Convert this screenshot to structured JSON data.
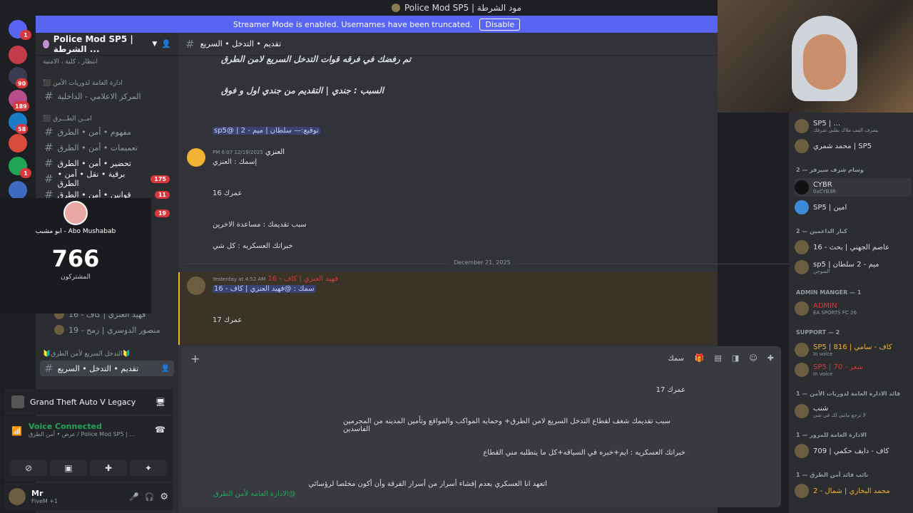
{
  "titlebar": {
    "title": "Police Mod SP5 | مود الشرطة"
  },
  "banner": {
    "text": "Streamer Mode is enabled. Usernames have been truncated.",
    "button": "Disable"
  },
  "server_badges": [
    "1",
    "90",
    "189",
    "58",
    "1",
    "1"
  ],
  "server": {
    "name": "Police Mod SP5 | الشرطة ..."
  },
  "categories": [
    {
      "label": "انتظار ، كلية ، الامنية"
    },
    {
      "label": "⬛ ادارة العامة لدوريات الأمن"
    },
    {
      "label": "⬛ امــن الطـــرق"
    },
    {
      "label": "🔰التدخل السريع لأمن الطرق🔰"
    }
  ],
  "channels": [
    {
      "label": "المركز الاعلامي - الداخلية"
    },
    {
      "label": "مفهوم • أمن • الطرق"
    },
    {
      "label": "تعميمات • أمن • الطرق"
    },
    {
      "label": "تحضير • أمن • الطرق"
    },
    {
      "label": "برقية • نقل • أمن • الطرق",
      "badge": "175"
    },
    {
      "label": "قوانين • أمن • الطرق",
      "badge": "11"
    },
    {
      "label": "19",
      "badge": "19"
    },
    {
      "label": "تقديم • التدخل • السريع",
      "active": true
    }
  ],
  "voice_members": [
    {
      "label": "فهيد العنزي | كاف - 16"
    },
    {
      "label": "منصور الدوسري | زمح - 19"
    }
  ],
  "overlay": {
    "name": "ابو مشبب - Abo Mushabab",
    "count": "766",
    "label": "المشتركون"
  },
  "game": {
    "title": "Grand Theft Auto V Legacy"
  },
  "voice": {
    "status": "Voice Connected",
    "sub": "عرض • أمن الطرق / Police Mod SP5 | ..."
  },
  "user": {
    "name": "Mr",
    "status": "FiveM +1"
  },
  "chat": {
    "header": "تقديم • التدخل • السريع"
  },
  "messages": [
    {
      "text": "تم رفضك في فرقه قوات التدخل السريع لامن الطرق"
    },
    {
      "text": "السبب : جندي | التقديم من جندي اول و فوق"
    },
    {
      "text": "توقيع:— سلطان | ميم - 2 | @sp5"
    },
    {
      "author": "العنزي",
      "time": "12/19/2025 6:07 PM"
    },
    {
      "text": "إسمك : العنزي"
    },
    {
      "text": "عمرك 16"
    },
    {
      "text": "سبب تقديمك : مساعدة الاخرين"
    },
    {
      "text": "خبراتك العسكريه : كل شي"
    },
    {
      "author": "فهيد العنزي | كاف - 16",
      "time": "Yesterday at 4:52 AM"
    },
    {
      "text": "سمك : @فهيد العنزي | كاف - 16"
    },
    {
      "text": "عمرك 17"
    }
  ],
  "divider": "December 21, 2025",
  "composer": {
    "lines": [
      "سمك",
      "عمرك 17",
      "سبب تقديمك شغف لقطاع التدخل السريع لامن الطرق+ وحمايه المواكب والمواقع وتأمين المدينه من المجرمين الفاسدين",
      "خبراتك العسكريه : ايم+خبره في السياقه+كل ما يتطلبه مني القطاع",
      "اتعهد انا العسكري بعدم إفشاء أسرار من أسرار الفرقة وأن أكون مخلصا لرؤسائي",
      "@الادارة العامة لأمن الطرق"
    ]
  },
  "members": {
    "groups": [
      {
        "title": "وسام شرف سيرفر — 2"
      },
      {
        "title": "كبار الداعمين — 2"
      },
      {
        "title": "ADMIN MANGER — 1"
      },
      {
        "title": "SUPPORT — 2"
      },
      {
        "title": "قائد الادارة العامة لدوريات الأمن — 1"
      },
      {
        "title": "الادارة العامة للمرور — 1"
      },
      {
        "title": "نائب قائد أمن الطرق — 1"
      }
    ],
    "items": [
      {
        "name": "SP5 | ...",
        "sub": "يشرف الفف ملاك بقلبي شرفك"
      },
      {
        "name": "محمد شمري | SP5",
        "sub": ""
      },
      {
        "name": "CYBR",
        "sub": "0xCYB3R"
      },
      {
        "name": "SP5 | امين",
        "sub": ""
      },
      {
        "name": "عاصم الجهني | بحث - 16",
        "sub": ""
      },
      {
        "name": "sp5 | ميم - 2 سلطان",
        "sub": "السوجن"
      },
      {
        "name": "ADMIN",
        "sub": "EA SPORTS FC 26"
      },
      {
        "name": "SP5 | 816 | كاف - سامي",
        "sub": "In voice"
      },
      {
        "name": "SP5 | 70 - شعر",
        "sub": "In voice"
      },
      {
        "name": "شنب",
        "sub": "لا ترجع ماتبي لك في شي"
      },
      {
        "name": "709 | كاف - دايف حكمي",
        "sub": ""
      },
      {
        "name": "محمد البخاري | شمال - 2",
        "sub": ""
      }
    ]
  }
}
